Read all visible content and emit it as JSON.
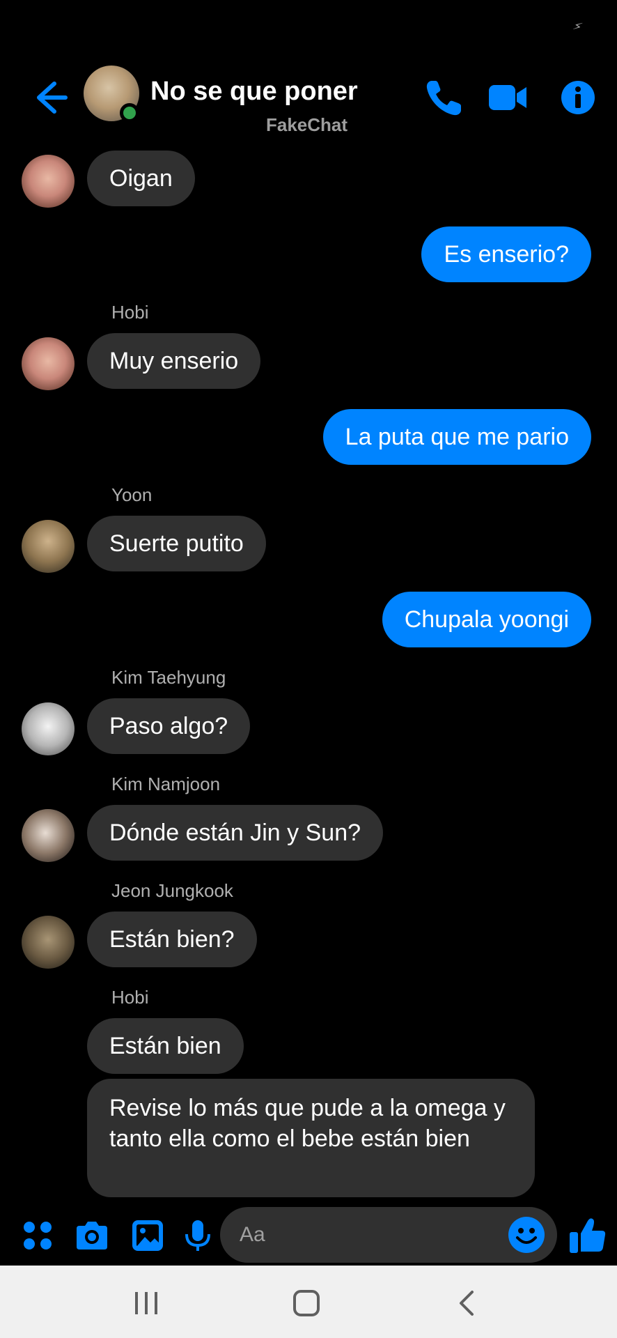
{
  "status_bar": {
    "glyph": "⚡"
  },
  "header": {
    "title": "No se que poner",
    "subtitle": "FakeChat",
    "icons": [
      "back-arrow-icon",
      "phone-icon",
      "video-camera-icon",
      "info-icon"
    ]
  },
  "messages": [
    {
      "type": "in",
      "sender": "",
      "text": "Oigan"
    },
    {
      "type": "out",
      "text": "Es enserio?"
    },
    {
      "type": "in",
      "sender": "Hobi",
      "text": "Muy enserio"
    },
    {
      "type": "out",
      "text": "La puta que me pario"
    },
    {
      "type": "in",
      "sender": "Yoon",
      "text": "Suerte putito"
    },
    {
      "type": "out",
      "text": "Chupala yoongi"
    },
    {
      "type": "in",
      "sender": "Kim Taehyung",
      "text": "Paso algo?"
    },
    {
      "type": "in",
      "sender": "Kim Namjoon",
      "text": "Dónde están Jin y Sun?"
    },
    {
      "type": "in",
      "sender": "Jeon Jungkook",
      "text": "Están bien?"
    },
    {
      "type": "in",
      "sender": "Hobi",
      "text": "Están bien"
    },
    {
      "type": "in",
      "sender": "",
      "text": "Revise lo más que pude a la omega y tanto ella como el bebe están bien"
    }
  ],
  "composer": {
    "placeholder": "Aa",
    "icons": [
      "apps-grid-icon",
      "camera-icon",
      "image-icon",
      "microphone-icon",
      "emoji-icon",
      "thumbs-up-icon"
    ]
  },
  "colors": {
    "accent": "#0084ff",
    "incoming_bubble": "#303030",
    "online": "#31a24c"
  }
}
